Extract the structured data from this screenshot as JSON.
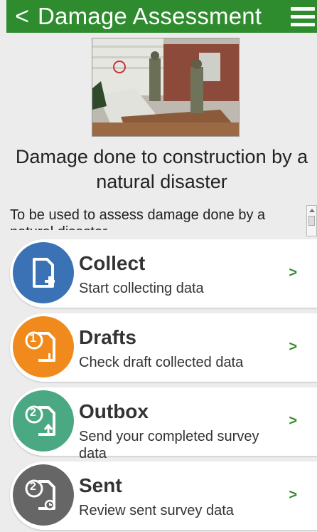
{
  "header": {
    "back_glyph": "<",
    "title": "Damage Assessment"
  },
  "content": {
    "headline": "Damage done to construction by a natural disaster",
    "description": "To be used to assess damage done by a natural disaster"
  },
  "actions": [
    {
      "title": "Collect",
      "subtitle": "Start collecting data",
      "color": "#3a72b5",
      "chevron": ">"
    },
    {
      "title": "Drafts",
      "subtitle": "Check draft collected data",
      "badge": "1",
      "color": "#f08a1c",
      "chevron": ">"
    },
    {
      "title": "Outbox",
      "subtitle": "Send your completed survey data",
      "badge": "2",
      "color": "#4aa882",
      "chevron": ">"
    },
    {
      "title": "Sent",
      "subtitle": "Review sent survey data",
      "badge": "2",
      "color": "#666666",
      "chevron": ">"
    }
  ]
}
